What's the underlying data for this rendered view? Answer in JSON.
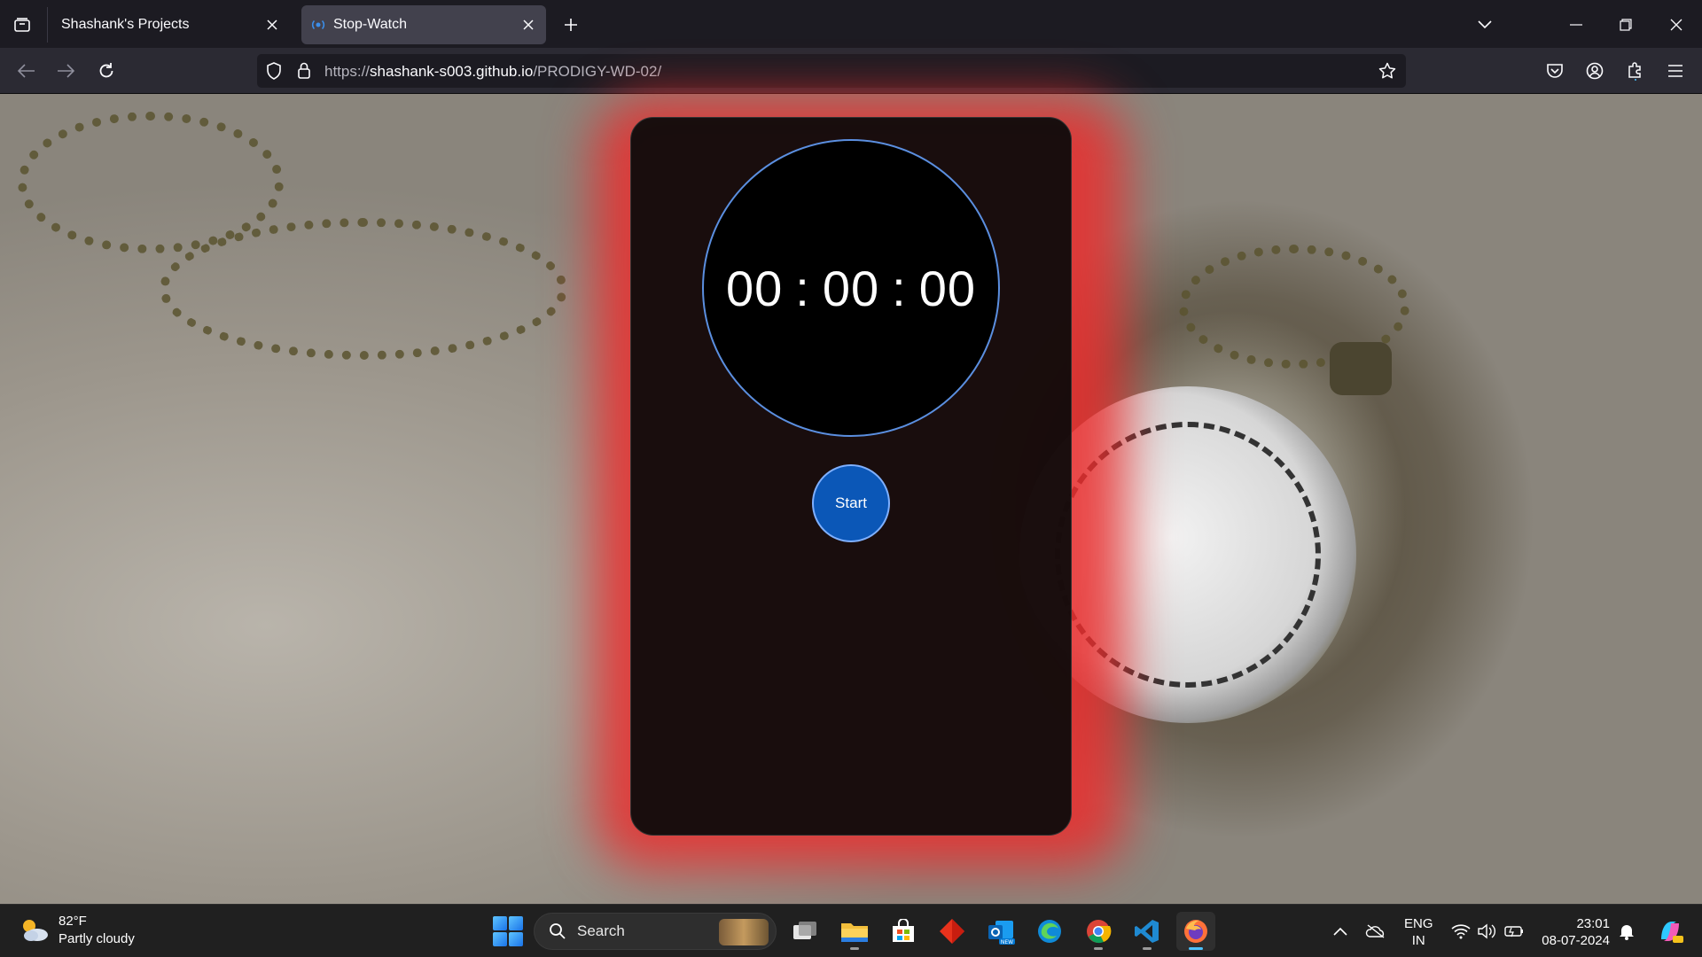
{
  "browser": {
    "tabs": [
      {
        "title": "Shashank's Projects",
        "active": false
      },
      {
        "title": "Stop-Watch",
        "active": true
      }
    ],
    "url_prefix": "https://",
    "url_host": "shashank-s003.github.io",
    "url_path": "/PRODIGY-WD-02/"
  },
  "stopwatch": {
    "hours": "00",
    "minutes": "00",
    "seconds": "00",
    "separator": ":",
    "start_label": "Start"
  },
  "taskbar": {
    "weather_temp": "82°F",
    "weather_desc": "Partly cloudy",
    "search_label": "Search",
    "lang_line1": "ENG",
    "lang_line2": "IN",
    "time": "23:01",
    "date": "08-07-2024",
    "apps": [
      "task-view",
      "file-explorer",
      "microsoft-store",
      "red-diamond-app",
      "outlook-new",
      "edge",
      "chrome",
      "vscode",
      "firefox"
    ]
  },
  "colors": {
    "accent_glow": "#eb2d2d",
    "start_button": "#0b57b7",
    "clock_border": "#5b8fe0",
    "firefox_active_indicator": "#4cc2ff"
  }
}
